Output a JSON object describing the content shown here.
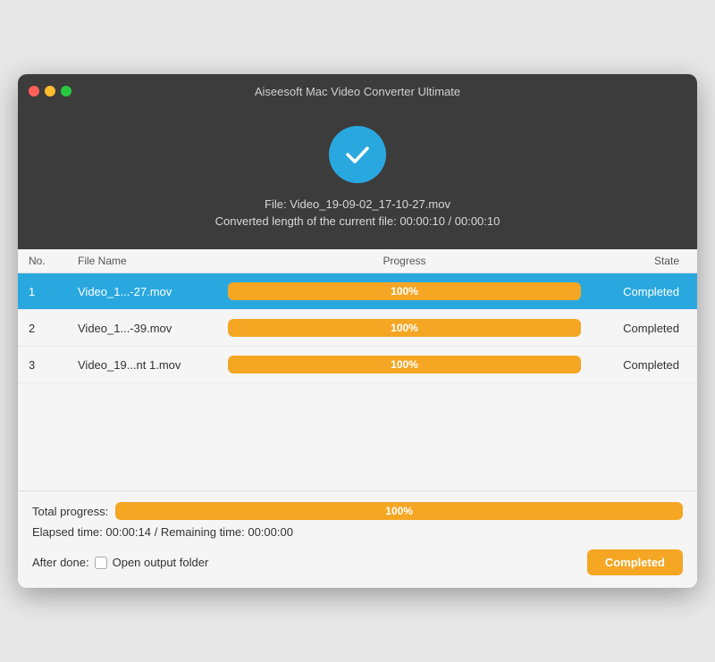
{
  "window": {
    "title": "Aiseesoft Mac Video Converter Ultimate"
  },
  "header": {
    "file_label": "File: Video_19-09-02_17-10-27.mov",
    "length_label": "Converted length of the current file: 00:00:10 / 00:00:10"
  },
  "table": {
    "columns": {
      "no": "No.",
      "file_name": "File Name",
      "progress": "Progress",
      "state": "State"
    },
    "rows": [
      {
        "no": "1",
        "filename": "Video_1...-27.mov",
        "progress": 100,
        "progress_label": "100%",
        "state": "Completed",
        "selected": true
      },
      {
        "no": "2",
        "filename": "Video_1...-39.mov",
        "progress": 100,
        "progress_label": "100%",
        "state": "Completed",
        "selected": false
      },
      {
        "no": "3",
        "filename": "Video_19...nt 1.mov",
        "progress": 100,
        "progress_label": "100%",
        "state": "Completed",
        "selected": false
      }
    ]
  },
  "footer": {
    "total_progress_label": "Total progress:",
    "total_progress_value": 100,
    "total_progress_text": "100%",
    "elapsed_label": "Elapsed time: 00:00:14 / Remaining time: 00:00:00",
    "after_done_label": "After done:",
    "open_folder_label": "Open output folder",
    "completed_button_label": "Completed"
  },
  "traffic_lights": {
    "close": "close",
    "minimize": "minimize",
    "maximize": "maximize"
  }
}
